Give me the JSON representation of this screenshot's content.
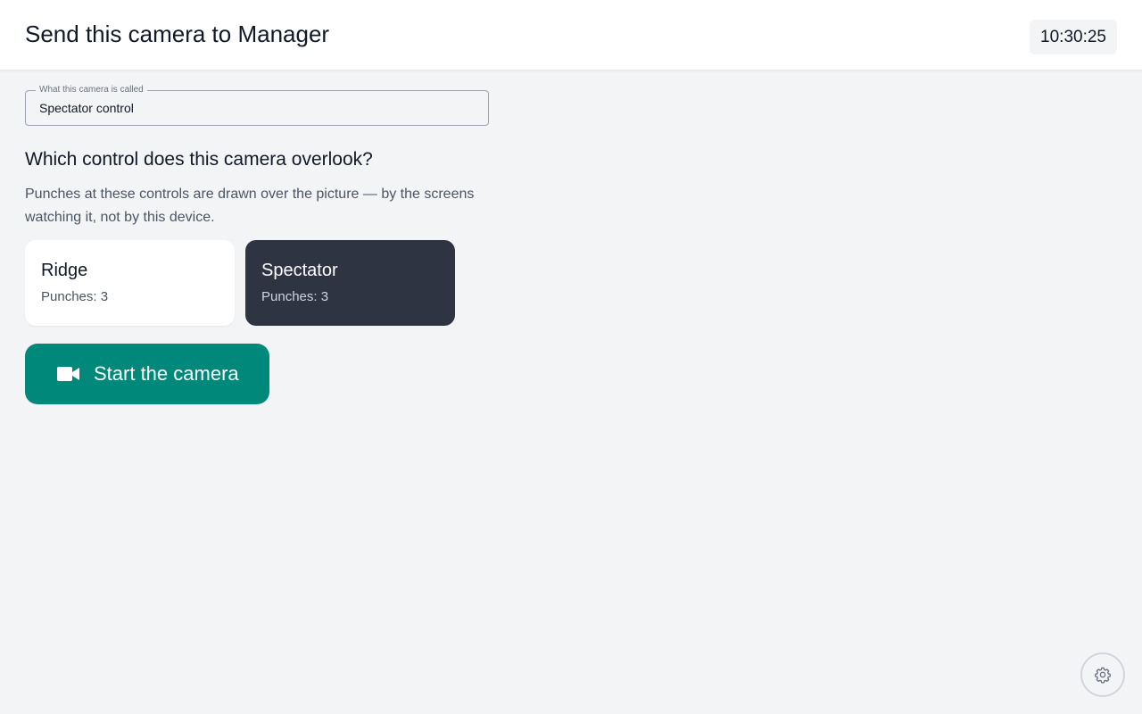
{
  "header": {
    "title": "Send this camera to Manager",
    "clock": "10:30:25"
  },
  "camera_name": {
    "legend": "What this camera is called",
    "value": "Spectator control"
  },
  "control_select": {
    "question": "Which control does this camera overlook?",
    "helper": "Punches at these controls are drawn over the picture — by the screens watching it, not by this device.",
    "selected": "Spectator",
    "controls": [
      {
        "name": "Ridge",
        "punches": "Punches: 3"
      },
      {
        "name": "Spectator",
        "punches": "Punches: 3"
      }
    ]
  },
  "start_button": {
    "label": "Start the camera",
    "icon": "video-camera-icon"
  },
  "settings": {
    "icon": "gear-icon"
  },
  "colors": {
    "accent": "#00897b",
    "selected_card": "#2f3442",
    "background": "#f3f4f6"
  }
}
